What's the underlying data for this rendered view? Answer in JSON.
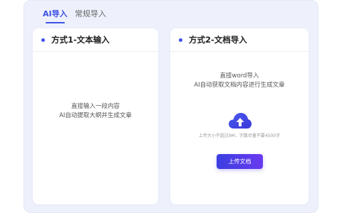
{
  "tabs": [
    {
      "label": "AI导入",
      "active": true
    },
    {
      "label": "常规导入",
      "active": false
    }
  ],
  "cards": {
    "text_input": {
      "title": "方式1-文本输入",
      "desc_line1": "直接输入一段内容",
      "desc_line2": "AI自动提取大纲并生成文章"
    },
    "doc_import": {
      "title": "方式2-文档导入",
      "desc_line1": "直接word导入",
      "desc_line2": "AI自动获取文档内容进行生成文章",
      "icon": "cloud-upload-icon",
      "limit_text": "上传大小不超过9M，字数尽量不要4500字",
      "button_label": "上传文档"
    }
  },
  "colors": {
    "accent": "#3d52e6",
    "button_gradient_start": "#3b3fe0",
    "button_gradient_end": "#6a3af0",
    "panel_bg": "#eef1fc"
  }
}
